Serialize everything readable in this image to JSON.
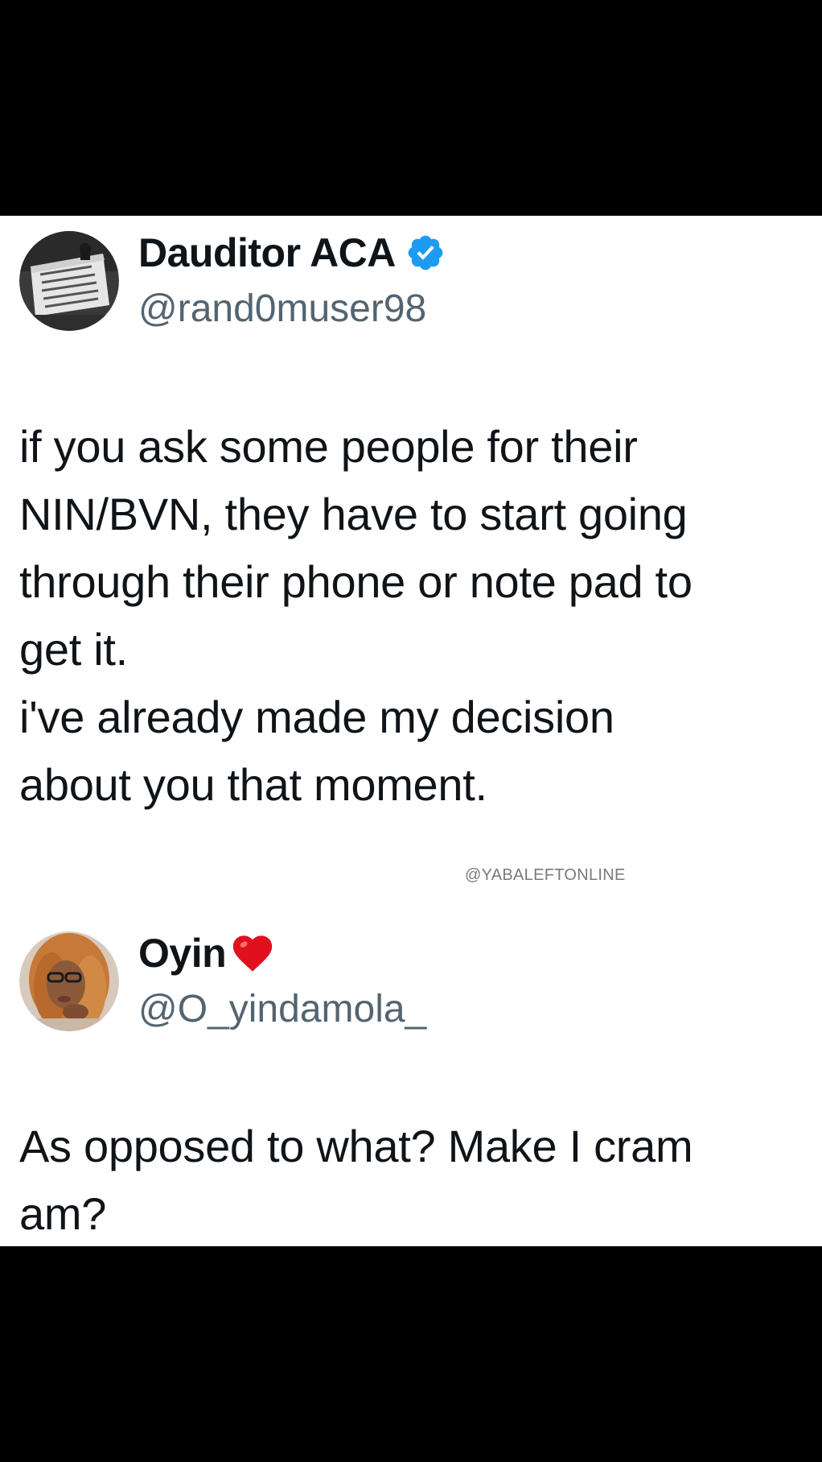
{
  "tweets": [
    {
      "display_name": "Dauditor ACA",
      "handle": "@rand0muser98",
      "verified": true,
      "avatar_icon": "protest-sign-avatar",
      "body_lines": [
        "if you ask some people for their",
        "NIN/BVN, they have to start going",
        "through their phone or note pad to",
        "get it.",
        "i've already made my decision",
        "about you that moment."
      ]
    },
    {
      "display_name": "Oyin",
      "name_emoji": "red-heart-icon",
      "handle": "@O_yindamola_",
      "verified": false,
      "avatar_icon": "profile-photo-avatar",
      "body_lines": [
        "As opposed to what? Make I cram",
        "am?"
      ]
    }
  ],
  "watermark": "@YABALEFTONLINE",
  "colors": {
    "background_band": "#000000",
    "card": "#ffffff",
    "text": "#0f1419",
    "handle": "#536471",
    "verified_blue": "#1d9bf0",
    "heart_red": "#e0101f"
  }
}
